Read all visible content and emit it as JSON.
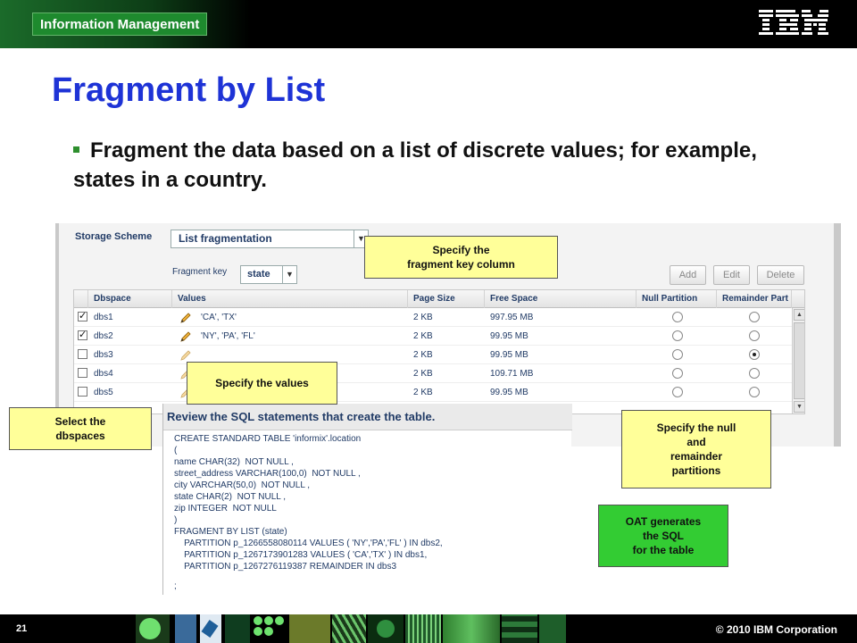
{
  "header": {
    "product": "Information Management",
    "brand": "IBM"
  },
  "slide": {
    "title": "Fragment by List",
    "bullet": "Fragment the data based on a list of discrete values; for example, states in a country."
  },
  "form": {
    "storage_scheme_label": "Storage Scheme",
    "storage_scheme_value": "List fragmentation",
    "fragment_key_label": "Fragment key",
    "fragment_key_value": "state",
    "buttons": {
      "add": "Add",
      "edit": "Edit",
      "delete": "Delete"
    }
  },
  "table": {
    "columns": [
      "Dbspace",
      "Values",
      "Page Size",
      "Free Space",
      "Null Partition",
      "Remainder Part"
    ],
    "rows": [
      {
        "checked": true,
        "dbspace": "dbs1",
        "values": "'CA', 'TX'",
        "page_size": "2 KB",
        "free_space": "997.95 MB",
        "null_partition": false,
        "remainder": false
      },
      {
        "checked": true,
        "dbspace": "dbs2",
        "values": "'NY', 'PA', 'FL'",
        "page_size": "2 KB",
        "free_space": "99.95 MB",
        "null_partition": false,
        "remainder": false
      },
      {
        "checked": false,
        "dbspace": "dbs3",
        "values": "",
        "page_size": "2 KB",
        "free_space": "99.95 MB",
        "null_partition": false,
        "remainder": true
      },
      {
        "checked": false,
        "dbspace": "dbs4",
        "values": "",
        "page_size": "2 KB",
        "free_space": "109.71 MB",
        "null_partition": false,
        "remainder": false
      },
      {
        "checked": false,
        "dbspace": "dbs5",
        "values": "",
        "page_size": "2 KB",
        "free_space": "99.95 MB",
        "null_partition": false,
        "remainder": false
      }
    ]
  },
  "sql": {
    "heading": "Review the SQL statements that create the table.",
    "lines": [
      "CREATE STANDARD TABLE 'informix'.location",
      "(",
      "name CHAR(32)  NOT NULL ,",
      "street_address VARCHAR(100,0)  NOT NULL ,",
      "city VARCHAR(50,0)  NOT NULL ,",
      "state CHAR(2)  NOT NULL ,",
      "zip INTEGER  NOT NULL",
      ")",
      "FRAGMENT BY LIST (state)",
      "    PARTITION p_1266558080114 VALUES ( 'NY','PA','FL' ) IN dbs2,",
      "    PARTITION p_1267173901283 VALUES ( 'CA','TX' ) IN dbs1,",
      "    PARTITION p_1267276119387 REMAINDER IN dbs3",
      "",
      ";"
    ]
  },
  "callouts": {
    "fragment_key": "Specify the\nfragment key column",
    "values": "Specify the values",
    "dbspaces": "Select the\ndbspaces",
    "null_remainder": "Specify the null\nand\nremainder\npartitions",
    "oat": "OAT generates\nthe SQL\nfor  the table"
  },
  "footer": {
    "page": "21",
    "copyright": "© 2010 IBM Corporation"
  },
  "colors": {
    "title": "#1e33d6",
    "callout_yellow": "#ffff99",
    "callout_green": "#33cc33",
    "bullet": "#2e8f2e"
  }
}
